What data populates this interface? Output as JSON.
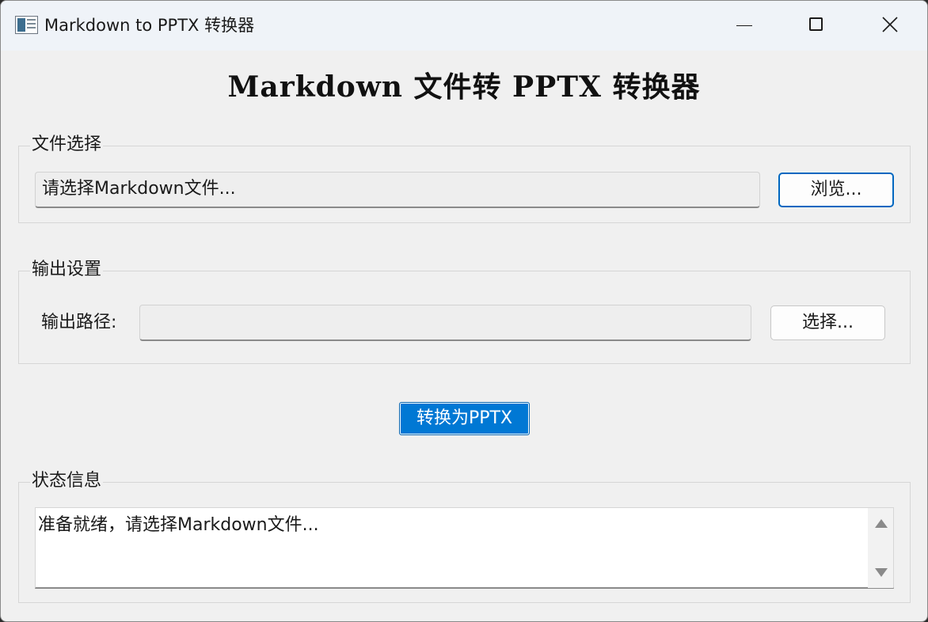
{
  "window": {
    "title": "Markdown to PPTX 转换器",
    "icon": "app-window-icon",
    "controls": {
      "minimize": "minimize-icon",
      "maximize": "maximize-icon",
      "close": "close-icon"
    }
  },
  "heading": "Markdown 文件转 PPTX 转换器",
  "file_group": {
    "label": "文件选择",
    "path_placeholder": "请选择Markdown文件...",
    "browse_label": "浏览..."
  },
  "output_group": {
    "label": "输出设置",
    "path_label": "输出路径:",
    "path_value": "",
    "choose_label": "选择..."
  },
  "convert_button": "转换为PPTX",
  "status_group": {
    "label": "状态信息",
    "text": "准备就绪，请选择Markdown文件..."
  },
  "colors": {
    "accent": "#0078d4",
    "window_bg": "#f0f0f0",
    "titlebar_bg": "#eff3f8"
  }
}
